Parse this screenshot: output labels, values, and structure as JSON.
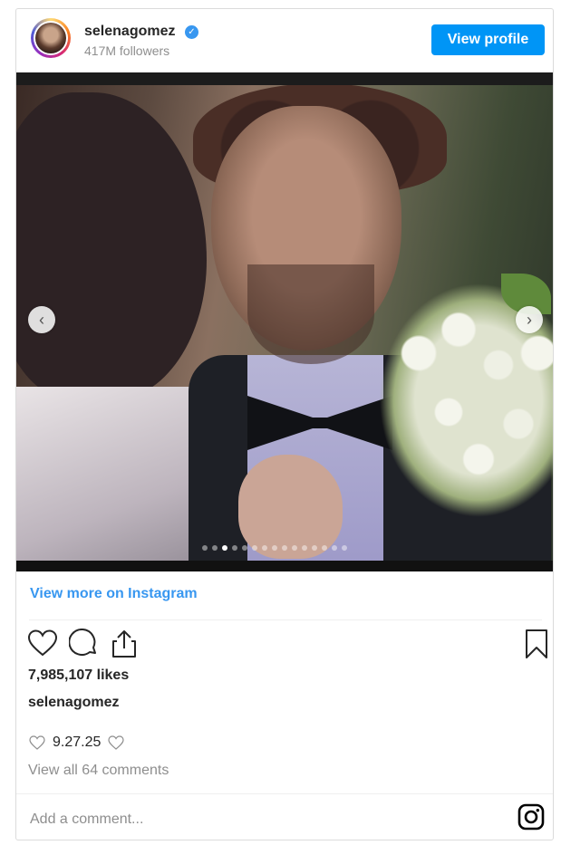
{
  "header": {
    "username": "selenagomez",
    "verified_icon": "verified-badge-icon",
    "followers": "417M followers",
    "view_profile_label": "View profile"
  },
  "media": {
    "prev_icon": "chevron-left-icon",
    "next_icon": "chevron-right-icon",
    "prev_glyph": "‹",
    "next_glyph": "›",
    "slide_count": 15,
    "active_slide": 3
  },
  "view_more_label": "View more on Instagram",
  "actions": {
    "like_icon": "heart-icon",
    "comment_icon": "comment-icon",
    "share_icon": "share-icon",
    "save_icon": "bookmark-icon"
  },
  "likes": "7,985,107 likes",
  "caption": {
    "username": "selenagomez",
    "text": "9.27.25"
  },
  "comments_link": "View all 64 comments",
  "add_comment": {
    "placeholder": "Add a comment..."
  },
  "colors": {
    "accent": "#0095f6",
    "link": "#3897f0",
    "muted": "#8e8e8e"
  }
}
